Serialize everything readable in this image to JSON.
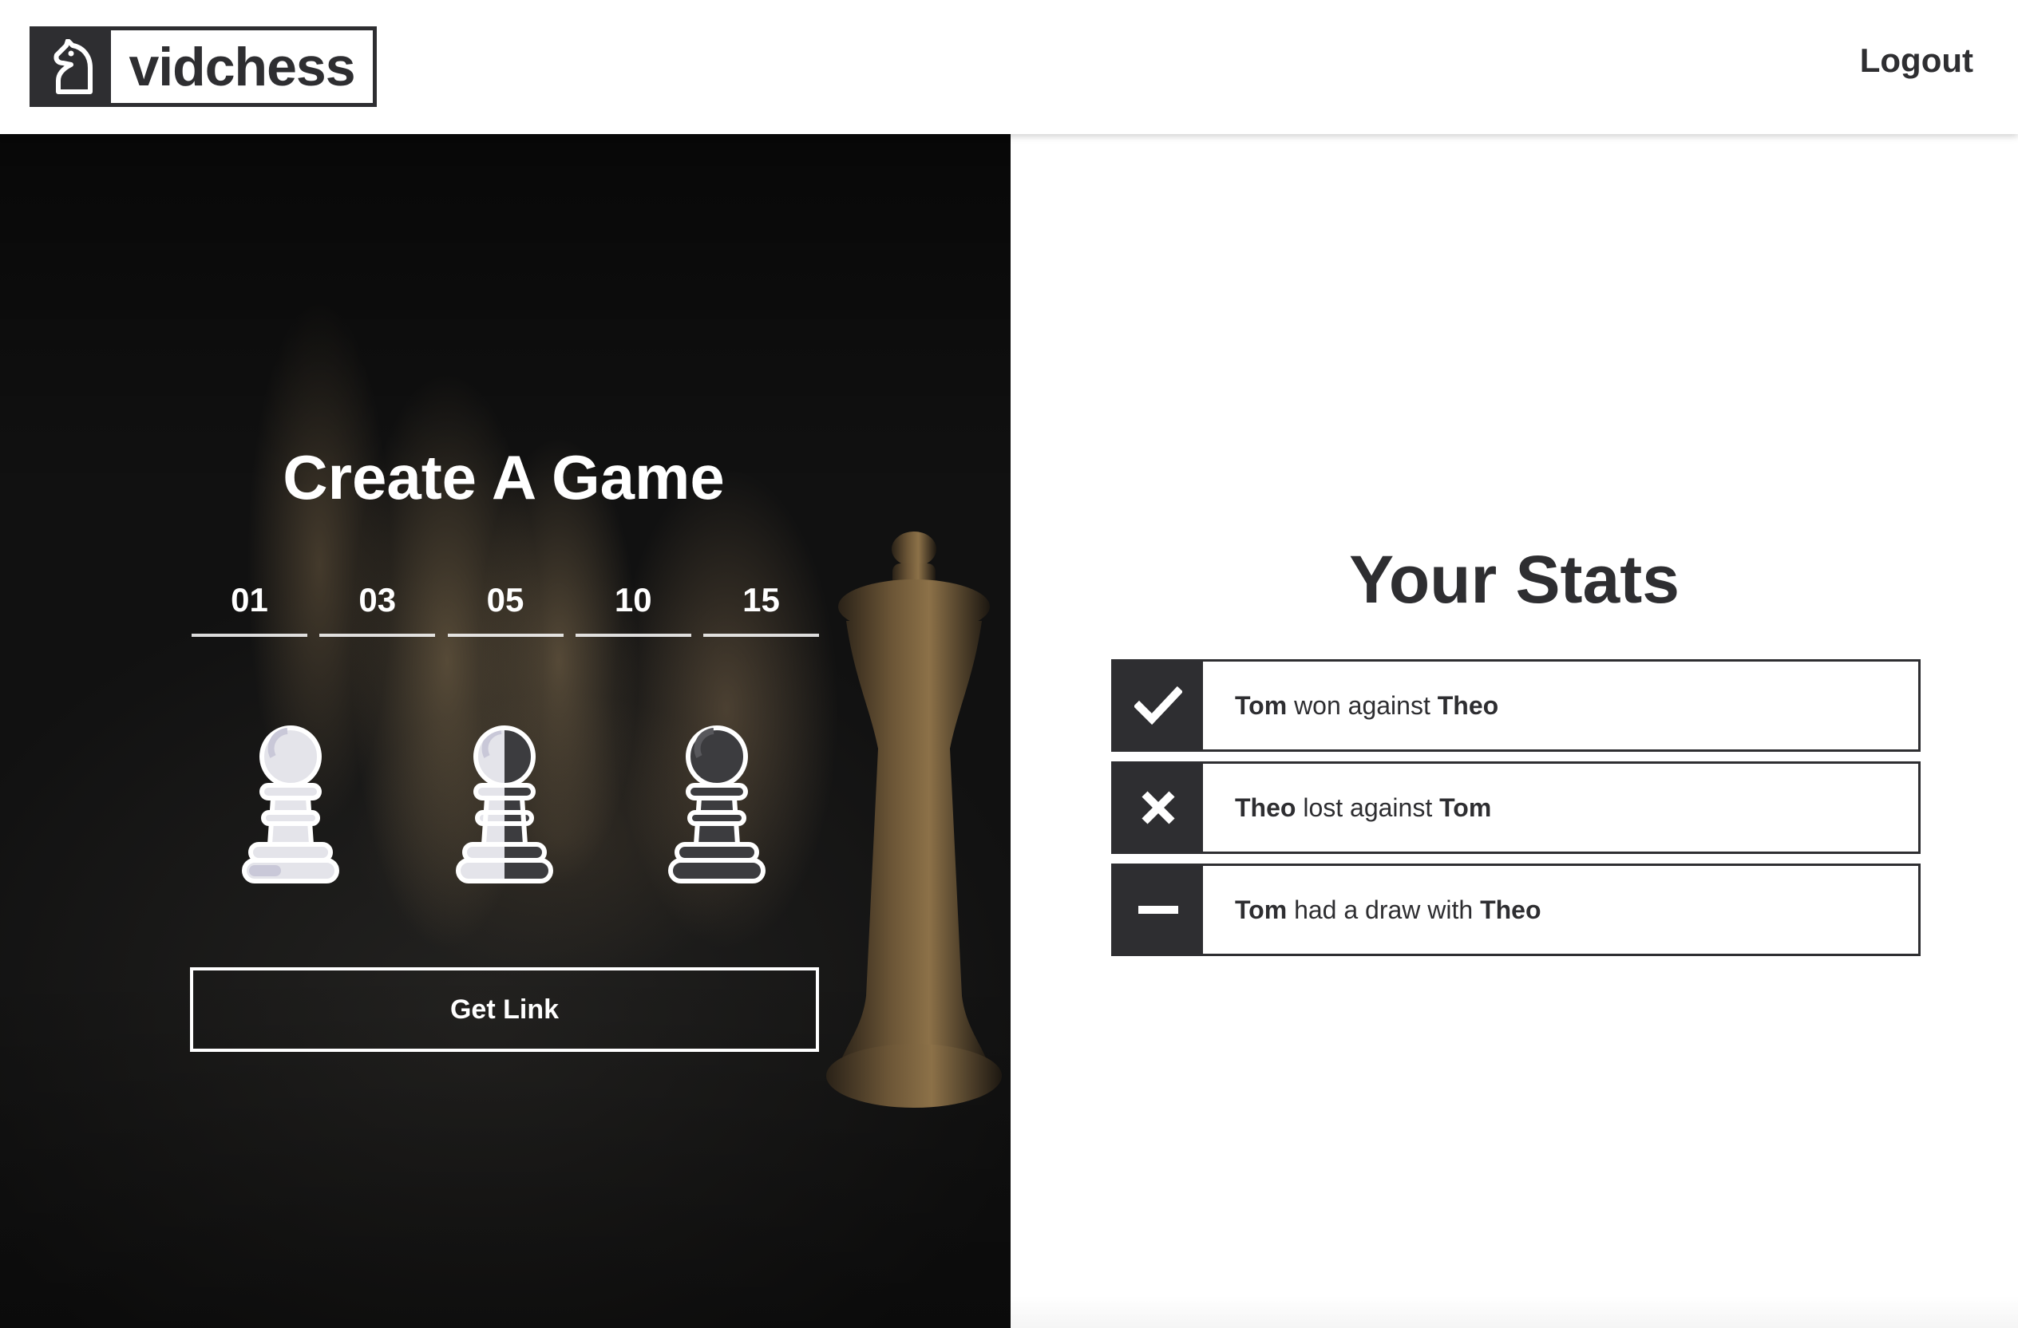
{
  "header": {
    "brand": "vidchess",
    "logout_label": "Logout"
  },
  "create": {
    "title": "Create A Game",
    "time_options": [
      "01",
      "03",
      "05",
      "10",
      "15"
    ],
    "color_options": [
      "white-pawn-icon",
      "half-white-half-black-pawn-icon",
      "black-pawn-icon"
    ],
    "button_label": "Get Link"
  },
  "stats": {
    "title": "Your Stats",
    "rows": [
      {
        "icon": "check-icon",
        "player": "Tom",
        "verb": " won against ",
        "opponent": "Theo"
      },
      {
        "icon": "cross-icon",
        "player": "Theo",
        "verb": " lost against ",
        "opponent": "Tom"
      },
      {
        "icon": "minus-icon",
        "player": "Tom",
        "verb": " had a draw with ",
        "opponent": "Theo"
      }
    ]
  },
  "colors": {
    "dark": "#2e2e31",
    "white": "#ffffff",
    "pawn_light": "#e4e4ea",
    "pawn_shade": "#c9c8d8",
    "pawn_dark": "#3c3c3f"
  }
}
